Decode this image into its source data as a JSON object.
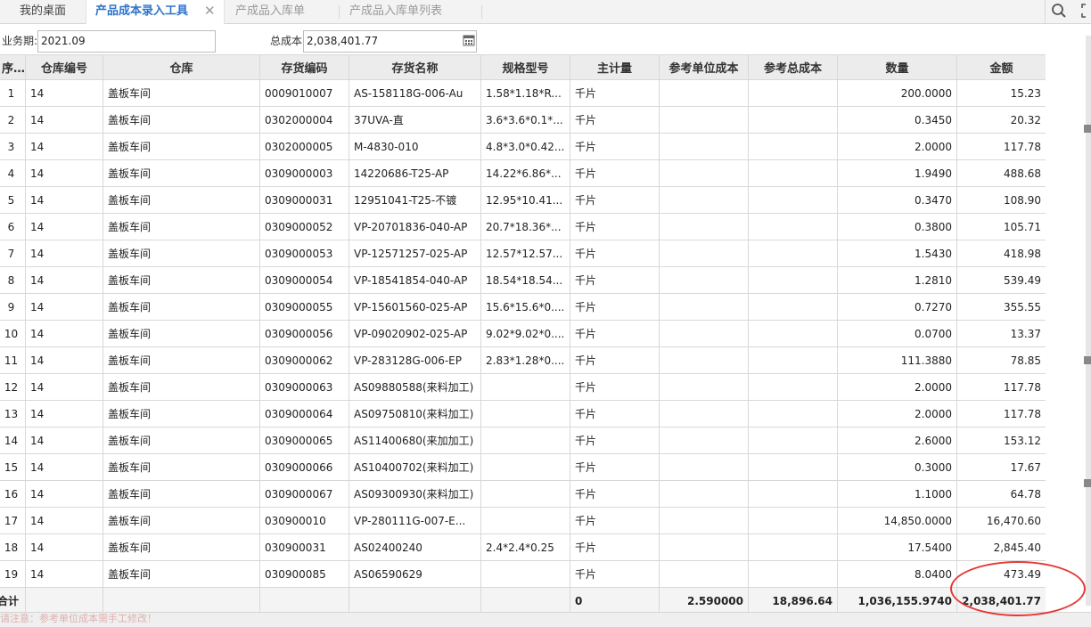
{
  "tabs": {
    "home": "我的桌面",
    "active": "产品成本录入工具",
    "close_glyph": "✕",
    "inactive": [
      "产成品入库单",
      "产成品入库单列表"
    ]
  },
  "form": {
    "period_label": "业务期:",
    "period_value": "2021.09",
    "total_cost_label": "总成本",
    "total_cost_value": "2,038,401.77"
  },
  "grid": {
    "headers": [
      "序号",
      "仓库编号",
      "仓库",
      "存货编码",
      "存货名称",
      "规格型号",
      "主计量",
      "参考单位成本",
      "参考总成本",
      "数量",
      "金额"
    ],
    "rows": [
      [
        "1",
        "14",
        "盖板车间",
        "0009010007",
        "AS-158118G-006-Au",
        "1.58*1.18*R...",
        "千片",
        "",
        "",
        "200.0000",
        "15.23"
      ],
      [
        "2",
        "14",
        "盖板车间",
        "0302000004",
        "37UVA-直",
        "3.6*3.6*0.1*...",
        "千片",
        "",
        "",
        "0.3450",
        "20.32"
      ],
      [
        "3",
        "14",
        "盖板车间",
        "0302000005",
        "M-4830-010",
        "4.8*3.0*0.42...",
        "千片",
        "",
        "",
        "2.0000",
        "117.78"
      ],
      [
        "4",
        "14",
        "盖板车间",
        "0309000003",
        "14220686-T25-AP",
        "14.22*6.86*...",
        "千片",
        "",
        "",
        "1.9490",
        "488.68"
      ],
      [
        "5",
        "14",
        "盖板车间",
        "0309000031",
        "12951041-T25-不镀",
        "12.95*10.41...",
        "千片",
        "",
        "",
        "0.3470",
        "108.90"
      ],
      [
        "6",
        "14",
        "盖板车间",
        "0309000052",
        "VP-20701836-040-AP",
        "20.7*18.36*...",
        "千片",
        "",
        "",
        "0.3800",
        "105.71"
      ],
      [
        "7",
        "14",
        "盖板车间",
        "0309000053",
        "VP-12571257-025-AP",
        "12.57*12.57...",
        "千片",
        "",
        "",
        "1.5430",
        "418.98"
      ],
      [
        "8",
        "14",
        "盖板车间",
        "0309000054",
        "VP-18541854-040-AP",
        "18.54*18.54...",
        "千片",
        "",
        "",
        "1.2810",
        "539.49"
      ],
      [
        "9",
        "14",
        "盖板车间",
        "0309000055",
        "VP-15601560-025-AP",
        "15.6*15.6*0....",
        "千片",
        "",
        "",
        "0.7270",
        "355.55"
      ],
      [
        "10",
        "14",
        "盖板车间",
        "0309000056",
        "VP-09020902-025-AP",
        "9.02*9.02*0....",
        "千片",
        "",
        "",
        "0.0700",
        "13.37"
      ],
      [
        "11",
        "14",
        "盖板车间",
        "0309000062",
        "VP-283128G-006-EP",
        "2.83*1.28*0....",
        "千片",
        "",
        "",
        "111.3880",
        "78.85"
      ],
      [
        "12",
        "14",
        "盖板车间",
        "0309000063",
        "AS09880588(来料加工)",
        "",
        "千片",
        "",
        "",
        "2.0000",
        "117.78"
      ],
      [
        "13",
        "14",
        "盖板车间",
        "0309000064",
        "AS09750810(来料加工)",
        "",
        "千片",
        "",
        "",
        "2.0000",
        "117.78"
      ],
      [
        "14",
        "14",
        "盖板车间",
        "0309000065",
        "AS11400680(来加加工)",
        "",
        "千片",
        "",
        "",
        "2.6000",
        "153.12"
      ],
      [
        "15",
        "14",
        "盖板车间",
        "0309000066",
        "AS10400702(来料加工)",
        "",
        "千片",
        "",
        "",
        "0.3000",
        "17.67"
      ],
      [
        "16",
        "14",
        "盖板车间",
        "0309000067",
        "AS09300930(来料加工)",
        "",
        "千片",
        "",
        "",
        "1.1000",
        "64.78"
      ],
      [
        "17",
        "14",
        "盖板车间",
        "030900010",
        "VP-280111G-007-E...",
        "",
        "千片",
        "",
        "",
        "14,850.0000",
        "16,470.60"
      ],
      [
        "18",
        "14",
        "盖板车间",
        "030900031",
        "AS02400240",
        "2.4*2.4*0.25",
        "千片",
        "",
        "",
        "17.5400",
        "2,845.40"
      ],
      [
        "19",
        "14",
        "盖板车间",
        "030900085",
        "AS06590629",
        "",
        "千片",
        "",
        "",
        "8.0400",
        "473.49"
      ]
    ],
    "totals": {
      "label": "合计",
      "main_qty": "0",
      "ref_unit_cost": "2.590000",
      "ref_total_cost": "18,896.64",
      "quantity": "1,036,155.9740",
      "amount": "2,038,401.77"
    }
  },
  "footer": {
    "note": "请注意：参考单位成本需手工修改！"
  },
  "colors": {
    "accent": "#2e74c9",
    "highlight": "#e53935"
  },
  "icons": {
    "search": "search-icon",
    "expand": "expand-icon",
    "calendar": "calendar-icon",
    "close": "close-icon"
  }
}
